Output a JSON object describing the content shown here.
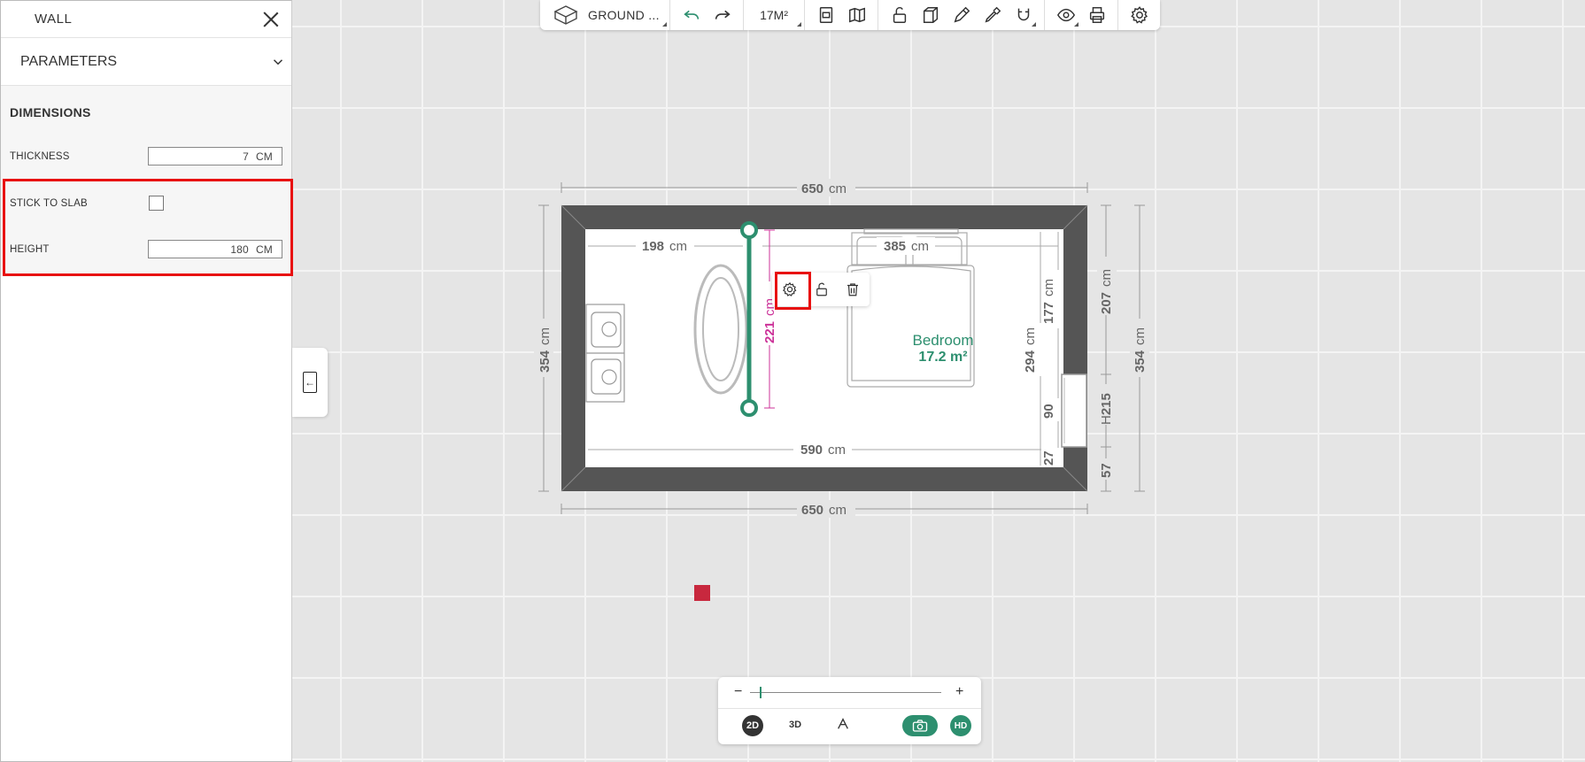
{
  "panel": {
    "title": "WALL",
    "section_label": "PARAMETERS",
    "dimensions_title": "DIMENSIONS",
    "thickness": {
      "label": "THICKNESS",
      "value": "7",
      "unit": "CM"
    },
    "stick_to_slab": {
      "label": "STICK TO SLAB",
      "checked": false
    },
    "height": {
      "label": "HEIGHT",
      "value": "180",
      "unit": "CM"
    }
  },
  "toolbar": {
    "level": "GROUND ...",
    "area": "17M²"
  },
  "plan": {
    "top_width": "650",
    "bottom_width": "650",
    "left_height": "354",
    "right_height": "354",
    "inner_left_width": "198",
    "inner_right_width": "385",
    "inner_bottom_width": "590",
    "wall_length": "221",
    "right_seg_top": "207",
    "right_seg_mid": "215",
    "right_seg_mid_prefix": "H",
    "right_seg_bottom": "57",
    "inner_right_total": "294",
    "inner_right_177": "177",
    "inner_right_90": "90",
    "inner_right_27": "27",
    "unit": "cm",
    "room_name": "Bedroom",
    "room_area": "17.2 m²"
  },
  "zoom": {
    "minus": "−",
    "plus": "+",
    "level": 0.05
  },
  "views": {
    "two_d": "2D",
    "three_d": "3D",
    "hd": "HD"
  },
  "colors": {
    "accent": "#2d8f6f",
    "highlight": "#e81010",
    "wall_dim": "#cc3399"
  }
}
